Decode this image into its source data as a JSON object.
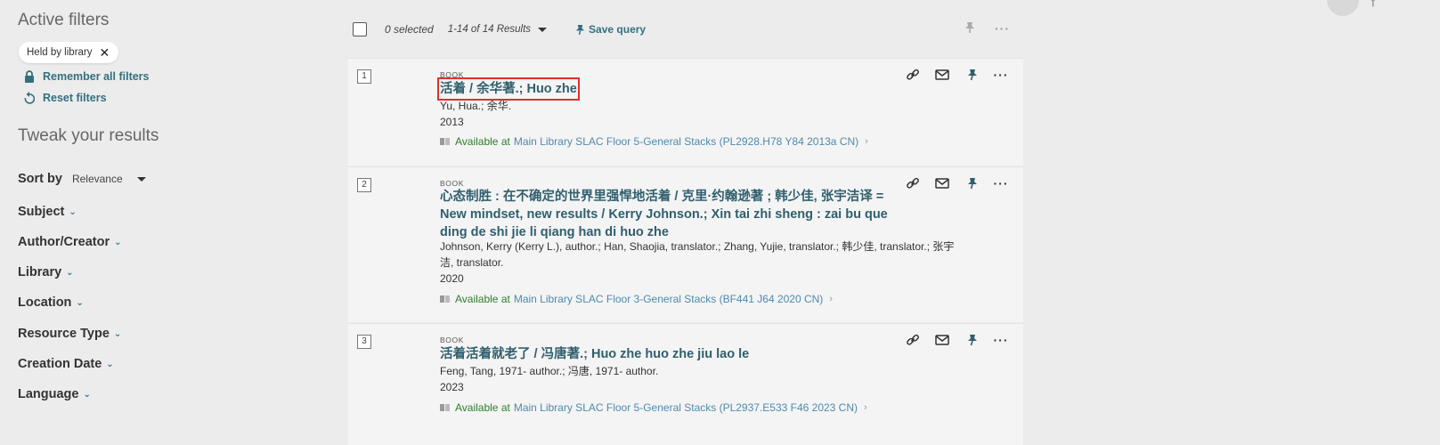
{
  "sidebar": {
    "active_filters_title": "Active filters",
    "filter_chip": "Held by library",
    "remember_label": "Remember all filters",
    "reset_label": "Reset filters",
    "tweak_title": "Tweak your results",
    "sort_label": "Sort by",
    "sort_value": "Relevance",
    "facets": [
      "Subject",
      "Author/Creator",
      "Library",
      "Location",
      "Resource Type",
      "Creation Date",
      "Language"
    ]
  },
  "toolbar": {
    "selected": "0 selected",
    "range": "1-14 of 14 Results",
    "save_query": "Save query"
  },
  "results": [
    {
      "num": "1",
      "type": "BOOK",
      "title": "活着 / 余华著.; Huo zhe",
      "author": "Yu, Hua.; 余华.",
      "year": "2013",
      "avail_status": "Available at",
      "avail_location": "Main Library  SLAC Floor 5-General Stacks (PL2928.H78 Y84 2013a CN)"
    },
    {
      "num": "2",
      "type": "BOOK",
      "title": "心态制胜 : 在不确定的世界里强悍地活着 / 克里·约翰逊著 ; 韩少佳, 张宇洁译 = New mindset, new results / Kerry Johnson.; Xin tai zhi sheng : zai bu que ding de shi jie li qiang han di huo zhe",
      "author": "Johnson, Kerry (Kerry L.), author.; Han, Shaojia, translator.; Zhang, Yujie, translator.; 韩少佳, translator.; 张宇洁, translator.",
      "year": "2020",
      "avail_status": "Available at",
      "avail_location": "Main Library  SLAC Floor 3-General Stacks (BF441 J64 2020 CN)"
    },
    {
      "num": "3",
      "type": "BOOK",
      "title": "活着活着就老了 / 冯唐著.; Huo zhe huo zhe jiu lao le",
      "author": "Feng, Tang, 1971- author.; 冯唐, 1971- author.",
      "year": "2023",
      "avail_status": "Available at",
      "avail_location": "Main Library  SLAC Floor 5-General Stacks (PL2937.E533 F46 2023 CN)"
    }
  ],
  "icons": {
    "lock": "lock-icon",
    "reset": "reset-icon",
    "pin": "pin-icon",
    "link": "link-icon",
    "email": "email-icon",
    "more": "more-icon",
    "book": "book-icon"
  },
  "colors": {
    "accent": "#33707f",
    "title": "#305f6e",
    "available": "#2d7d2d",
    "location": "#4f8aad",
    "highlight_box": "#e0302a"
  }
}
